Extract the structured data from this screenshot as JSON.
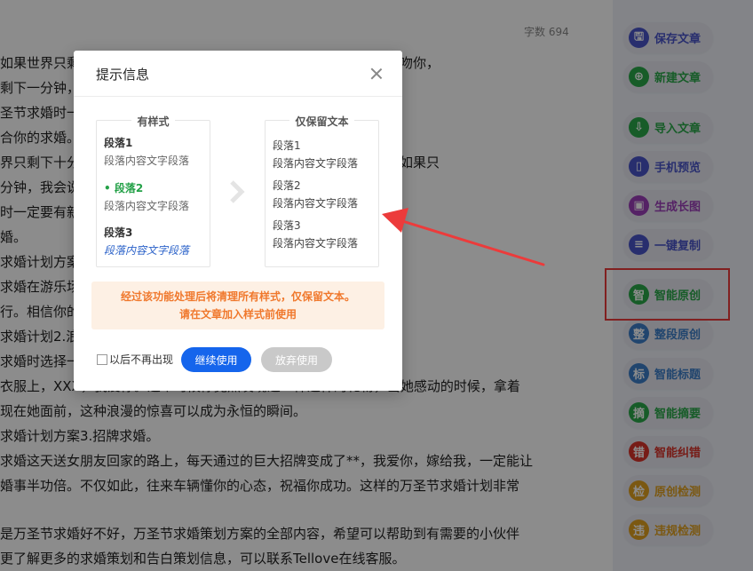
{
  "editor": {
    "word_count": "字数 694",
    "lines": [
      "如果世界只剩下十分钟，我会陪着你；如果世界只剩下三分钟，我会吻你，",
      "剩下一分钟，我会说我爱你。相信很多人都没有想到这种求婚的想",
      "圣节求婚时一定要有新意，下面是万圣节求婚策划方案，一起来",
      "合你的求婚。",
      "界只剩下十分钟，我会陪着你；如果世界只剩下三分钟，我会吻你，如果只",
      "分钟，我会说我爱你。相信很多人都没有想到这种求婚的想法。万圣",
      "时一定要有新意，下面是万圣节求婚策划方案，一起来看看适合",
      "婚。",
      "求婚计划方案",
      "求婚在游乐场，选择一些适合的游乐活动，如烟花晚会，比如漫画人",
      "行。相信你的女朋友会很开心，这样的求婚一定是童话浪漫。",
      "求婚计划2.浪漫舞蹈",
      "求婚时选择一些适合的音乐，带着她跳浪漫的舞蹈，舞蹈时发现印在",
      "衣服上，XXX，我爱你。这个时候你竟然发现这一件这样的礼物，当她感动的时候，拿着",
      "现在她面前，这种浪漫的惊喜可以成为永恒的瞬间。",
      "求婚计划方案3.招牌求婚。",
      "求婚这天送女朋友回家的路上，每天通过的巨大招牌变成了**，我爱你，嫁给我，一定能让",
      "婚事半功倍。不仅如此，往来车辆懂你的心态，祝福你成功。这样的万圣节求婚计划非常",
      "",
      "是万圣节求婚好不好，万圣节求婚策划方案的全部内容，希望可以帮助到有需要的小伙伴",
      "更了解更多的求婚策划和告白策划信息，可以联系Tellove在线客服。"
    ]
  },
  "toolbar": {
    "items": [
      {
        "icon": "save-icon",
        "glyph": "🖫",
        "label": "保存文章",
        "color": "#4a55c9"
      },
      {
        "icon": "new-doc-icon",
        "glyph": "⊕",
        "label": "新建文章",
        "color": "#2aa84a"
      },
      {
        "icon": "import-icon",
        "glyph": "⇩",
        "label": "导入文章",
        "color": "#2aa84a"
      },
      {
        "icon": "phone-icon",
        "glyph": "▯",
        "label": "手机预览",
        "color": "#4a55c9"
      },
      {
        "icon": "image-icon",
        "glyph": "▣",
        "label": "生成长图",
        "color": "#9c3fb8"
      },
      {
        "icon": "copy-icon",
        "glyph": "≡",
        "label": "一键复制",
        "color": "#4a55c9"
      },
      {
        "icon": "zhi-icon",
        "glyph": "智",
        "label": "智能原创",
        "color": "#2aa84a"
      },
      {
        "icon": "zheng-icon",
        "glyph": "整",
        "label": "整段原创",
        "color": "#3c7fc9"
      },
      {
        "icon": "biao-icon",
        "glyph": "标",
        "label": "智能标题",
        "color": "#3c7fc9"
      },
      {
        "icon": "zhai-icon",
        "glyph": "摘",
        "label": "智能摘要",
        "color": "#2aa84a"
      },
      {
        "icon": "cuo-icon",
        "glyph": "错",
        "label": "智能纠错",
        "color": "#d9342b"
      },
      {
        "icon": "jian-icon",
        "glyph": "检",
        "label": "原创检测",
        "color": "#e0a020"
      },
      {
        "icon": "wei-icon",
        "glyph": "违",
        "label": "违规检测",
        "color": "#e0a020"
      }
    ]
  },
  "dialog": {
    "title": "提示信息",
    "left_panel": {
      "title": "有样式",
      "p1_head": "段落1",
      "p1_body": "段落内容文字段落",
      "p2_head": "• 段落2",
      "p2_body": "段落内容文字段落",
      "p3_head": "段落3",
      "p3_body": "段落内容文字段落"
    },
    "right_panel": {
      "title": "仅保留文本",
      "p1_head": "段落1",
      "p1_body": "段落内容文字段落",
      "p2_head": "段落2",
      "p2_body": "段落内容文字段落",
      "p3_head": "段落3",
      "p3_body": "段落内容文字段落"
    },
    "notice_line1": "经过该功能处理后将清理所有样式，仅保留文本。",
    "notice_line2": "请在文章加入样式前使用",
    "dont_show_label": "以后不再出现",
    "continue_label": "继续使用",
    "cancel_label": "放弃使用"
  },
  "colors": {
    "primary": "#1565ec",
    "notice_text": "#f0782c",
    "notice_bg": "#fdf0e4",
    "highlight": "#ec3b3b"
  }
}
